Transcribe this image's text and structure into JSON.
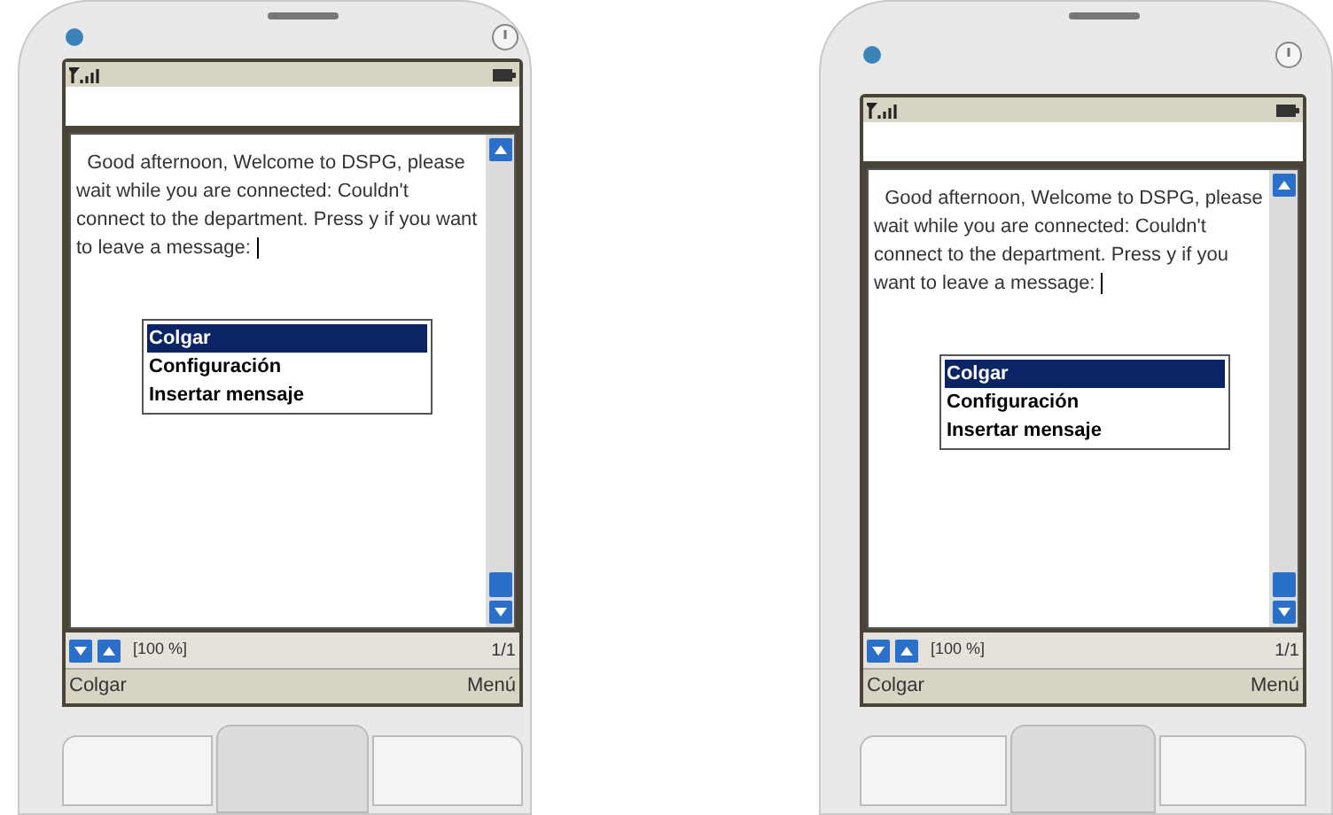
{
  "phones": [
    {
      "message": "  Good afternoon, Welcome to DSPG, please wait while you are connected: Couldn't connect to the department. Press y if you want to leave a message:",
      "menu": [
        {
          "label": "Colgar",
          "selected": true
        },
        {
          "label": "Configuración",
          "selected": false
        },
        {
          "label": "Insertar mensaje",
          "selected": false
        }
      ],
      "zoom": "[100 %]",
      "page": "1/1",
      "left_softkey": "Colgar",
      "right_softkey": "Menú"
    },
    {
      "message": "  Good afternoon, Welcome to DSPG, please wait while you are connected: Couldn't connect to the department. Press y if you want to leave a message:",
      "menu": [
        {
          "label": "Colgar",
          "selected": true
        },
        {
          "label": "Configuración",
          "selected": false
        },
        {
          "label": "Insertar mensaje",
          "selected": false
        }
      ],
      "zoom": "[100 %]",
      "page": "1/1",
      "left_softkey": "Colgar",
      "right_softkey": "Menú"
    }
  ]
}
